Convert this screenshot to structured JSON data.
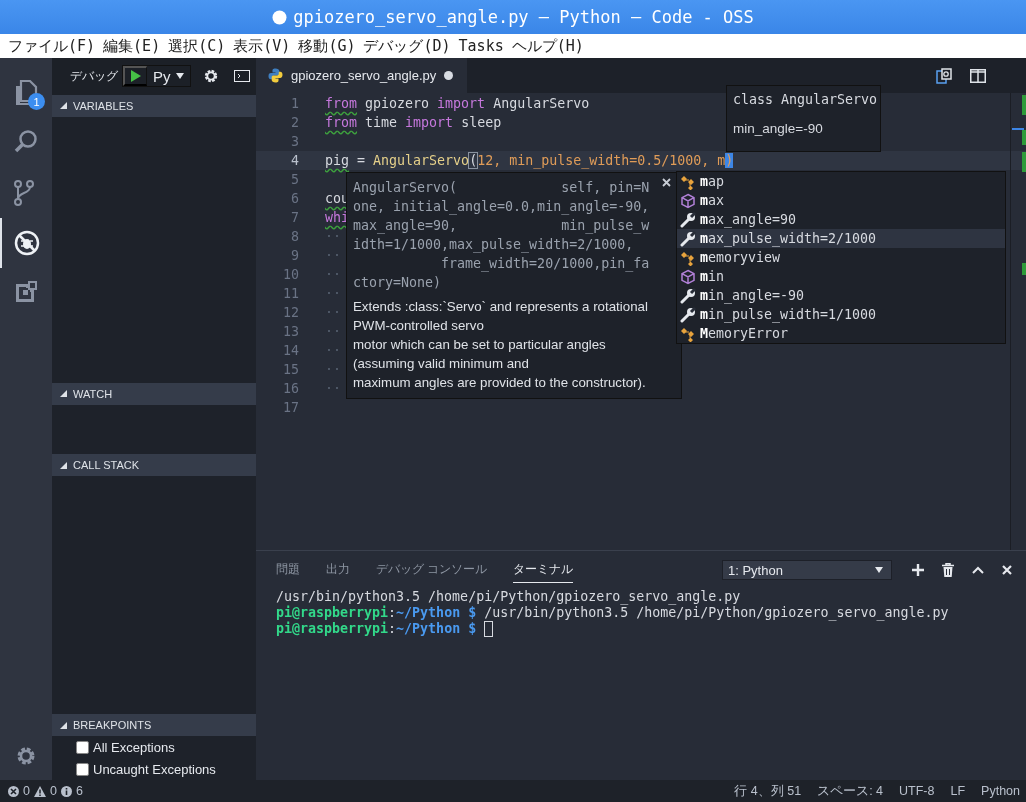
{
  "window": {
    "title": "gpiozero_servo_angle.py — Python — Code - OSS",
    "dirty": true
  },
  "menu": [
    "ファイル(F)",
    "編集(E)",
    "選択(C)",
    "表示(V)",
    "移動(G)",
    "デバッグ(D)",
    "Tasks",
    "ヘルプ(H)"
  ],
  "activity_bar": {
    "items": [
      {
        "kind": "files",
        "badge": "1",
        "selected": false
      },
      {
        "kind": "search",
        "selected": false
      },
      {
        "kind": "git",
        "selected": false
      },
      {
        "kind": "debug",
        "selected": true
      },
      {
        "kind": "extensions",
        "selected": false
      }
    ]
  },
  "debug_toolbar": {
    "label": "デバッグ",
    "configuration": "Py"
  },
  "sidebar": {
    "sections": [
      {
        "title": "VARIABLES",
        "expanded": true
      },
      {
        "title": "WATCH",
        "expanded": true
      },
      {
        "title": "CALL STACK",
        "expanded": true
      },
      {
        "title": "BREAKPOINTS",
        "expanded": true,
        "items": [
          {
            "label": "All Exceptions",
            "checked": false
          },
          {
            "label": "Uncaught Exceptions",
            "checked": false
          }
        ]
      }
    ]
  },
  "editor": {
    "tab": {
      "label": "gpiozero_servo_angle.py",
      "dirty": true
    },
    "lines": [
      {
        "number": "1",
        "current": false,
        "tokens": [
          {
            "kind": "kw",
            "text": "from",
            "squiggle": true
          },
          {
            "kind": "plain",
            "text": " gpiozero ",
            "squiggle": false
          },
          {
            "kind": "kw",
            "text": "import",
            "squiggle": false
          },
          {
            "kind": "plain",
            "text": " AngularServo",
            "squiggle": false
          }
        ]
      },
      {
        "number": "2",
        "current": false,
        "tokens": [
          {
            "kind": "kw",
            "text": "from",
            "squiggle": true
          },
          {
            "kind": "plain",
            "text": " time ",
            "squiggle": false
          },
          {
            "kind": "kw",
            "text": "import",
            "squiggle": false
          },
          {
            "kind": "plain",
            "text": " sleep",
            "squiggle": false
          }
        ]
      },
      {
        "number": "3",
        "current": false
      },
      {
        "number": "4",
        "current": true,
        "tokens": [
          {
            "kind": "plain",
            "text": "pig",
            "squiggle": true
          },
          {
            "kind": "plain",
            "text": " = ",
            "squiggle": false
          },
          {
            "kind": "fn",
            "text": "AngularServo",
            "squiggle": false
          },
          {
            "kind": "bracket",
            "text": "(",
            "squiggle": false
          },
          {
            "kind": "arg",
            "text": "12, min_pulse_width=0.5/1000, m",
            "squiggle": false
          },
          {
            "kind": "selection",
            "text": ")"
          }
        ]
      },
      {
        "number": "5",
        "current": false
      },
      {
        "number": "6",
        "current": false,
        "tokens": [
          {
            "kind": "plain",
            "text": "cou",
            "squiggle": true
          }
        ]
      },
      {
        "number": "7",
        "current": false,
        "tokens": [
          {
            "kind": "kw",
            "text": "whi",
            "squiggle": true
          }
        ]
      },
      {
        "number": "8",
        "current": false,
        "tokens": [
          {
            "kind": "ws",
            "text": "··",
            "squiggle": false
          }
        ]
      },
      {
        "number": "9",
        "current": false,
        "tokens": [
          {
            "kind": "ws",
            "text": "··",
            "squiggle": false
          }
        ]
      },
      {
        "number": "10",
        "current": false,
        "tokens": [
          {
            "kind": "ws",
            "text": "··",
            "squiggle": false
          }
        ]
      },
      {
        "number": "11",
        "current": false,
        "tokens": [
          {
            "kind": "ws",
            "text": "··",
            "squiggle": false
          }
        ]
      },
      {
        "number": "12",
        "current": false,
        "tokens": [
          {
            "kind": "ws",
            "text": "··",
            "squiggle": false
          }
        ]
      },
      {
        "number": "13",
        "current": false,
        "tokens": [
          {
            "kind": "ws",
            "text": "··",
            "squiggle": false
          }
        ]
      },
      {
        "number": "14",
        "current": false,
        "tokens": [
          {
            "kind": "ws",
            "text": "··",
            "squiggle": false
          }
        ]
      },
      {
        "number": "15",
        "current": false,
        "tokens": [
          {
            "kind": "ws",
            "text": "··",
            "squiggle": false
          }
        ]
      },
      {
        "number": "16",
        "current": false,
        "tokens": [
          {
            "kind": "ws",
            "text": "··",
            "squiggle": false
          }
        ]
      },
      {
        "number": "17",
        "current": false
      }
    ],
    "hover": {
      "signature": "class AngularServo",
      "detail": "min_angle=-90"
    },
    "parameter_hint": {
      "signature_lines": [
        "AngularServo(             self, pin=N",
        "one, initial_angle=0.0,min_angle=-90,",
        "max_angle=90,             min_pulse_w",
        "idth=1/1000,max_pulse_width=2/1000,",
        "           frame_width=20/1000,pin_fa",
        "ctory=None)"
      ],
      "doc_lines": [
        "Extends :class:`Servo` and represents a rotational",
        "PWM-controlled servo",
        "motor which can be set to particular angles",
        "(assuming valid minimum and",
        "maximum angles are provided to the constructor)."
      ]
    },
    "suggestions": [
      {
        "kind": "class",
        "label": "**m**ap",
        "selected": false
      },
      {
        "kind": "module",
        "label": "**m**ax",
        "selected": false
      },
      {
        "kind": "property",
        "label": "**m**ax_angle=90",
        "selected": false
      },
      {
        "kind": "property",
        "label": "**m**ax_pulse_width=2/1000",
        "selected": true
      },
      {
        "kind": "class",
        "label": "**m**emoryview",
        "selected": false
      },
      {
        "kind": "module",
        "label": "**m**in",
        "selected": false
      },
      {
        "kind": "property",
        "label": "**m**in_angle=-90",
        "selected": false
      },
      {
        "kind": "property",
        "label": "**m**in_pulse_width=1/1000",
        "selected": false
      },
      {
        "kind": "class",
        "label": "**M**emoryError",
        "selected": false
      }
    ]
  },
  "panel": {
    "tabs": [
      {
        "label": "問題",
        "selected": false
      },
      {
        "label": "出力",
        "selected": false
      },
      {
        "label": "デバッグ コンソール",
        "selected": false
      },
      {
        "label": "ターミナル",
        "selected": true
      }
    ],
    "terminal_select": "1: Python",
    "terminal_lines": [
      [
        {
          "kind": "plain",
          "text": "/usr/bin/python3.5 /home/pi/Python/gpiozero_servo_angle.py"
        }
      ],
      [
        {
          "kind": "user",
          "text": "pi@raspberrypi"
        },
        {
          "kind": "plain",
          "text": ":"
        },
        {
          "kind": "path",
          "text": "~/Python $"
        },
        {
          "kind": "plain",
          "text": " /usr/bin/python3.5 /home/pi/Python/gpiozero_servo_angle.py"
        }
      ],
      [
        {
          "kind": "user",
          "text": "pi@raspberrypi"
        },
        {
          "kind": "plain",
          "text": ":"
        },
        {
          "kind": "path",
          "text": "~/Python $"
        },
        {
          "kind": "cursor"
        }
      ]
    ]
  },
  "status_bar": {
    "errors": "0",
    "warnings": "0",
    "infos": "6",
    "position": "行 4、列 51",
    "indent": "スペース: 4",
    "encoding": "UTF-8",
    "eol": "LF",
    "language": "Python"
  }
}
